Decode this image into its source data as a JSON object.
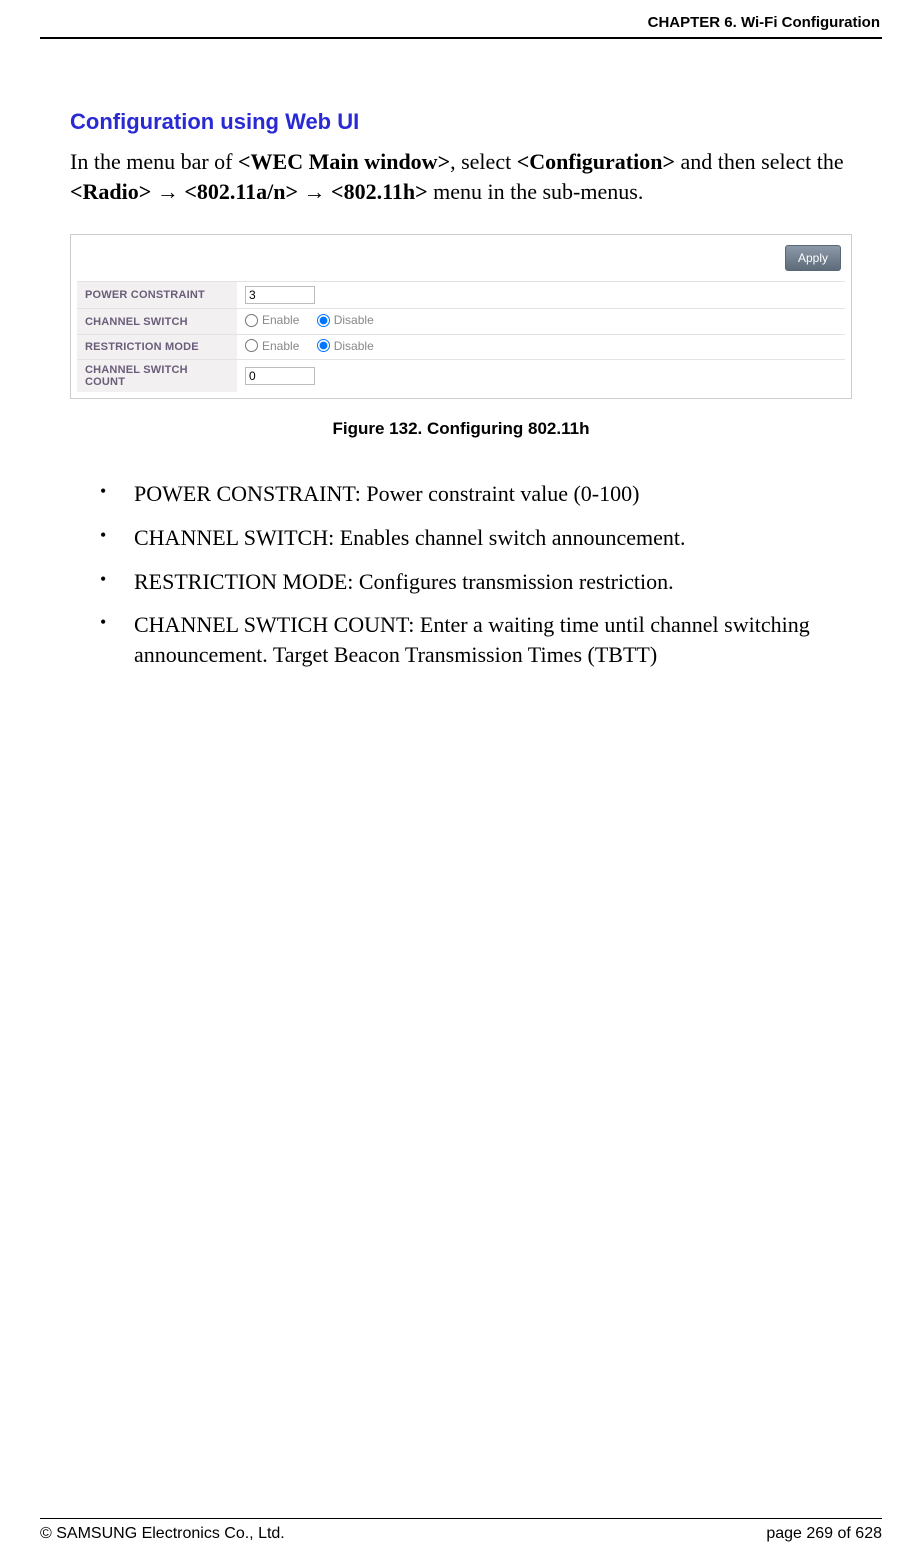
{
  "header": {
    "chapter": "CHAPTER 6. Wi-Fi Configuration"
  },
  "section": {
    "title": "Configuration using Web UI",
    "intro_parts": {
      "p1": "In the menu bar of ",
      "b1": "<WEC Main window>",
      "p2": ", select ",
      "b2": "<Configuration>",
      "p3": " and then select the ",
      "b3": "<Radio>",
      "arrow1": " → ",
      "b4": "<802.11a/n>",
      "arrow2": " → ",
      "b5": "<802.11h>",
      "p4": " menu in the sub-menus."
    }
  },
  "figure": {
    "apply_label": "Apply",
    "rows": {
      "power_constraint": {
        "label": "POWER CONSTRAINT",
        "value": "3"
      },
      "channel_switch": {
        "label": "CHANNEL SWITCH",
        "enable_label": "Enable",
        "disable_label": "Disable",
        "enable_checked": false,
        "disable_checked": true
      },
      "restriction_mode": {
        "label": "RESTRICTION MODE",
        "enable_label": "Enable",
        "disable_label": "Disable",
        "enable_checked": false,
        "disable_checked": true
      },
      "channel_switch_count": {
        "label": "CHANNEL SWITCH COUNT",
        "value": "0"
      }
    },
    "caption": "Figure 132. Configuring 802.11h"
  },
  "bullets": [
    "POWER CONSTRAINT: Power constraint value (0-100)",
    "CHANNEL SWITCH: Enables channel switch announcement.",
    "RESTRICTION MODE: Configures transmission restriction.",
    "CHANNEL SWTICH COUNT: Enter a waiting time until channel switching announcement. Target Beacon Transmission Times (TBTT)"
  ],
  "footer": {
    "copyright": "© SAMSUNG Electronics Co., Ltd.",
    "page": "page 269 of 628"
  }
}
